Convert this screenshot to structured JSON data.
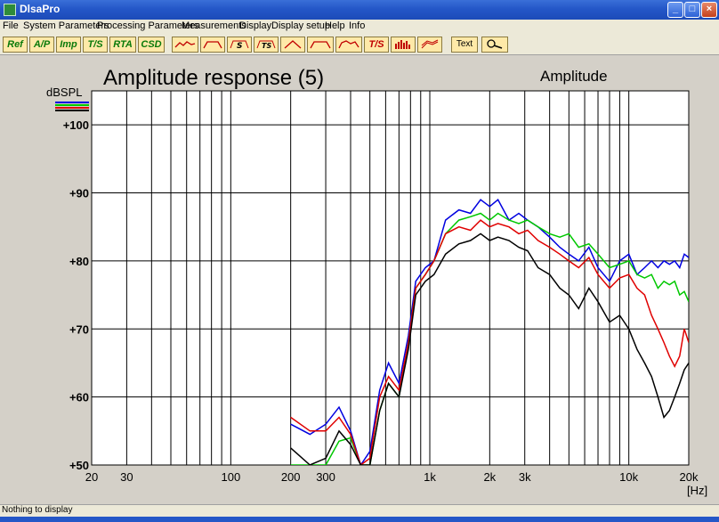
{
  "window": {
    "title": "DlsaPro",
    "minimize_label": "_",
    "maximize_label": "□",
    "close_label": "×"
  },
  "menu": {
    "items": [
      "File",
      "System Parameters",
      "Processing Parameters",
      "Measurements",
      "Display",
      "Display setup",
      "Help",
      "Info"
    ]
  },
  "toolbar": {
    "text_buttons": [
      "Ref",
      "A/P",
      "Imp",
      "T/S",
      "RTA",
      "CSD"
    ],
    "icon_buttons": [
      "amplitude-icon",
      "response-icon",
      "impulse-s-icon",
      "impulse-ts-icon",
      "triangle-icon",
      "step-icon",
      "bracket-icon"
    ],
    "ts_label": "T/S",
    "text_label": "Text"
  },
  "status": {
    "text": "Nothing to display"
  },
  "colors": {
    "plot_background": "#ffffff",
    "black_series": "#000000",
    "red_series": "#e00000",
    "green_series": "#00c800",
    "blue_series": "#0000e0"
  },
  "chart_data": {
    "type": "line",
    "title": "Amplitude response (5)",
    "subtitle": "Amplitude",
    "xlabel": "[Hz]",
    "ylabel": "dBSPL",
    "x_scale": "log",
    "xlim": [
      20,
      20000
    ],
    "ylim": [
      50,
      105
    ],
    "grid": true,
    "x_tick_labels": [
      {
        "value": 20,
        "label": "20"
      },
      {
        "value": 30,
        "label": "30"
      },
      {
        "value": 100,
        "label": "100"
      },
      {
        "value": 200,
        "label": "200"
      },
      {
        "value": 300,
        "label": "300"
      },
      {
        "value": 1000,
        "label": "1k"
      },
      {
        "value": 2000,
        "label": "2k"
      },
      {
        "value": 3000,
        "label": "3k"
      },
      {
        "value": 10000,
        "label": "10k"
      },
      {
        "value": 20000,
        "label": "20k"
      }
    ],
    "y_tick_labels": [
      {
        "value": 50,
        "label": "+50"
      },
      {
        "value": 60,
        "label": "+60"
      },
      {
        "value": 70,
        "label": "+70"
      },
      {
        "value": 80,
        "label": "+80"
      },
      {
        "value": 90,
        "label": "+90"
      },
      {
        "value": 100,
        "label": "+100"
      }
    ],
    "series": [
      {
        "color": "#0000e0",
        "x": [
          200,
          250,
          300,
          350,
          400,
          450,
          500,
          560,
          620,
          700,
          780,
          850,
          950,
          1050,
          1200,
          1400,
          1600,
          1800,
          2000,
          2200,
          2500,
          2800,
          3100,
          3500,
          4000,
          4500,
          5000,
          5600,
          6300,
          7000,
          8000,
          9000,
          10000,
          11000,
          12000,
          13000,
          14000,
          15000,
          16000,
          17000,
          18000,
          19000,
          20000
        ],
        "y": [
          56,
          54.5,
          56,
          58.5,
          55,
          50,
          52,
          61,
          65,
          62,
          69,
          77,
          79,
          80,
          86,
          87.5,
          87,
          89,
          88,
          89,
          86,
          87,
          86,
          85,
          83.5,
          82,
          81,
          80,
          82,
          79,
          77,
          80,
          81,
          78,
          79,
          80,
          79,
          80,
          79.5,
          80,
          79,
          81,
          80.5
        ]
      },
      {
        "color": "#00c800",
        "x": [
          200,
          250,
          300,
          350,
          400,
          450,
          500,
          560,
          620,
          700,
          780,
          850,
          950,
          1050,
          1200,
          1400,
          1600,
          1800,
          2000,
          2200,
          2500,
          2800,
          3100,
          3500,
          4000,
          4500,
          5000,
          5600,
          6300,
          7000,
          8000,
          9000,
          10000,
          11000,
          12000,
          13000,
          14000,
          15000,
          16000,
          17000,
          18000,
          19000,
          20000
        ],
        "y": [
          50,
          50,
          50,
          53.5,
          54,
          50,
          50,
          58,
          62,
          60,
          68,
          76,
          78,
          80,
          84,
          86,
          86.5,
          87,
          86,
          87,
          86,
          85.5,
          86,
          85,
          84,
          83.5,
          84,
          82,
          82.5,
          81,
          79,
          79.5,
          80,
          78,
          77.5,
          78,
          76,
          77,
          76.5,
          77,
          75,
          75.5,
          74
        ]
      },
      {
        "color": "#e00000",
        "x": [
          200,
          250,
          300,
          350,
          400,
          450,
          500,
          560,
          620,
          700,
          780,
          850,
          950,
          1050,
          1200,
          1400,
          1600,
          1800,
          2000,
          2200,
          2500,
          2800,
          3100,
          3500,
          4000,
          4500,
          5000,
          5600,
          6300,
          7000,
          8000,
          9000,
          10000,
          11000,
          12000,
          13000,
          14000,
          15000,
          16000,
          17000,
          18000,
          19000,
          20000
        ],
        "y": [
          57,
          55,
          55,
          57,
          54.5,
          50,
          51,
          60,
          63,
          61,
          68,
          76,
          78,
          80,
          84,
          85,
          84.5,
          86,
          85,
          85.5,
          85,
          84,
          84.5,
          83,
          82,
          81,
          80,
          79,
          80.5,
          78,
          76,
          77.5,
          78,
          76,
          75,
          72,
          70,
          68,
          66,
          64.5,
          66,
          70,
          68
        ]
      },
      {
        "color": "#000000",
        "x": [
          200,
          250,
          300,
          350,
          400,
          450,
          500,
          560,
          620,
          700,
          780,
          850,
          950,
          1050,
          1200,
          1400,
          1600,
          1800,
          2000,
          2200,
          2500,
          2800,
          3100,
          3500,
          4000,
          4500,
          5000,
          5600,
          6300,
          7000,
          8000,
          9000,
          10000,
          11000,
          12000,
          13000,
          14000,
          15000,
          16000,
          17000,
          18000,
          19000,
          20000
        ],
        "y": [
          52.5,
          50,
          51,
          55,
          53,
          50,
          50,
          58,
          62,
          60,
          67,
          75,
          77,
          78,
          81,
          82.5,
          83,
          84,
          83,
          83.5,
          83,
          82,
          81.5,
          79,
          78,
          76,
          75,
          73,
          76,
          74,
          71,
          72,
          70,
          67,
          65,
          63,
          60,
          57,
          58,
          60,
          62,
          64,
          65
        ]
      }
    ]
  }
}
